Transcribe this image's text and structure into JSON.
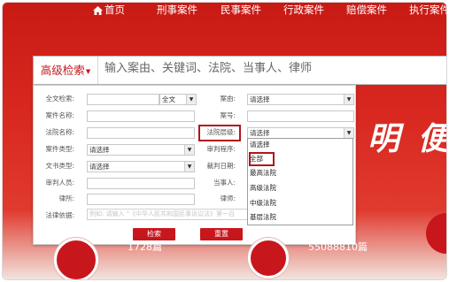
{
  "nav": {
    "items": [
      "首页",
      "刑事案件",
      "民事案件",
      "行政案件",
      "赔偿案件",
      "执行案件"
    ]
  },
  "slogan": "明 便民",
  "search": {
    "advanced_label": "高级检索",
    "placeholder": "输入案由、关键词、法院、当事人、律师"
  },
  "advanced_form": {
    "left_labels": {
      "fulltext": "全文检索:",
      "case_name": "案件名称:",
      "court_name": "法院名称:",
      "case_type": "案件类型:",
      "doc_type": "文书类型:",
      "judge": "审判人员:",
      "lawyer_office": "律所:",
      "legal_basis": "法律依据:"
    },
    "right_labels": {
      "cause": "案由:",
      "case_no": "案号:",
      "court_level": "法院层级:",
      "procedure": "审判程序:",
      "judgment_date": "裁判日期:",
      "party": "当事人:",
      "lawyer": "律师:"
    },
    "fulltext_scope": "全文",
    "select_default": "请选择",
    "legal_basis_hint": "例如: 请输入 \"《中华人民共和国民事诉讼法》第一百",
    "search_button": "检索",
    "reset_button": "重置"
  },
  "court_level_dropdown": {
    "options": [
      "请选择",
      "全部",
      "最高法院",
      "高级法院",
      "中级法院",
      "基层法院"
    ],
    "highlighted": "全部"
  },
  "stats": {
    "left_count": "1728篇",
    "right_count": "55088810篇"
  }
}
